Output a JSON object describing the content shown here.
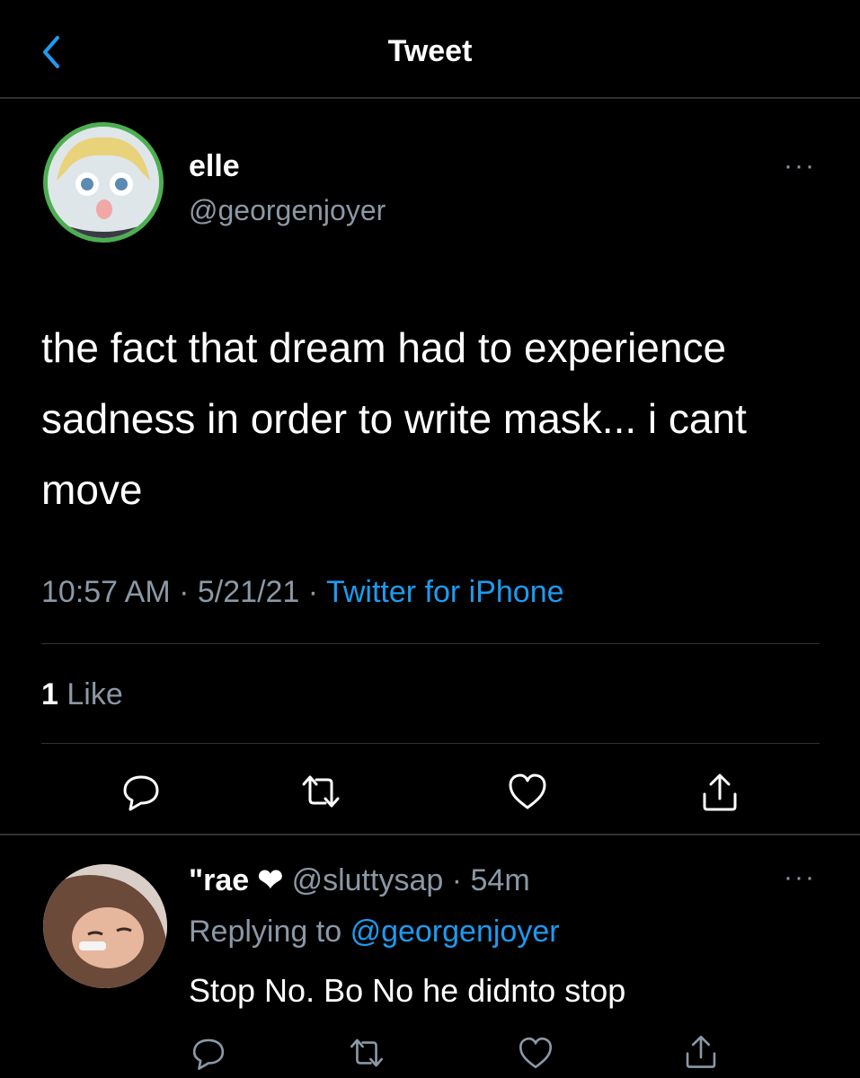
{
  "header": {
    "title": "Tweet",
    "back_icon": "chevron-left-icon"
  },
  "tweet": {
    "author_name": "elle",
    "author_handle": "@georgenjoyer",
    "more_label": "···",
    "text": "the fact that dream had to experience sadness in order to write mask... i cant move",
    "time": "10:57 AM",
    "date": "5/21/21",
    "source": "Twitter for iPhone",
    "likes_count": "1",
    "likes_label": "Like",
    "avatar_border_color": "#4caf50",
    "actions": [
      "reply-icon",
      "retweet-icon",
      "like-icon",
      "share-icon"
    ]
  },
  "reply": {
    "author_name": "\"rae",
    "author_heart": "❤",
    "author_handle": "@sluttysap",
    "age": "54m",
    "more_label": "···",
    "replying_prefix": "Replying to",
    "replying_to": "@georgenjoyer",
    "text": "Stop No. Bo No he didnto stop",
    "actions": [
      "reply-icon",
      "retweet-icon",
      "like-icon",
      "share-icon"
    ]
  },
  "colors": {
    "background": "#000000",
    "text": "#e7e9ea",
    "muted": "#8b98a5",
    "accent": "#1d9bf0",
    "divider": "#2f3336"
  }
}
